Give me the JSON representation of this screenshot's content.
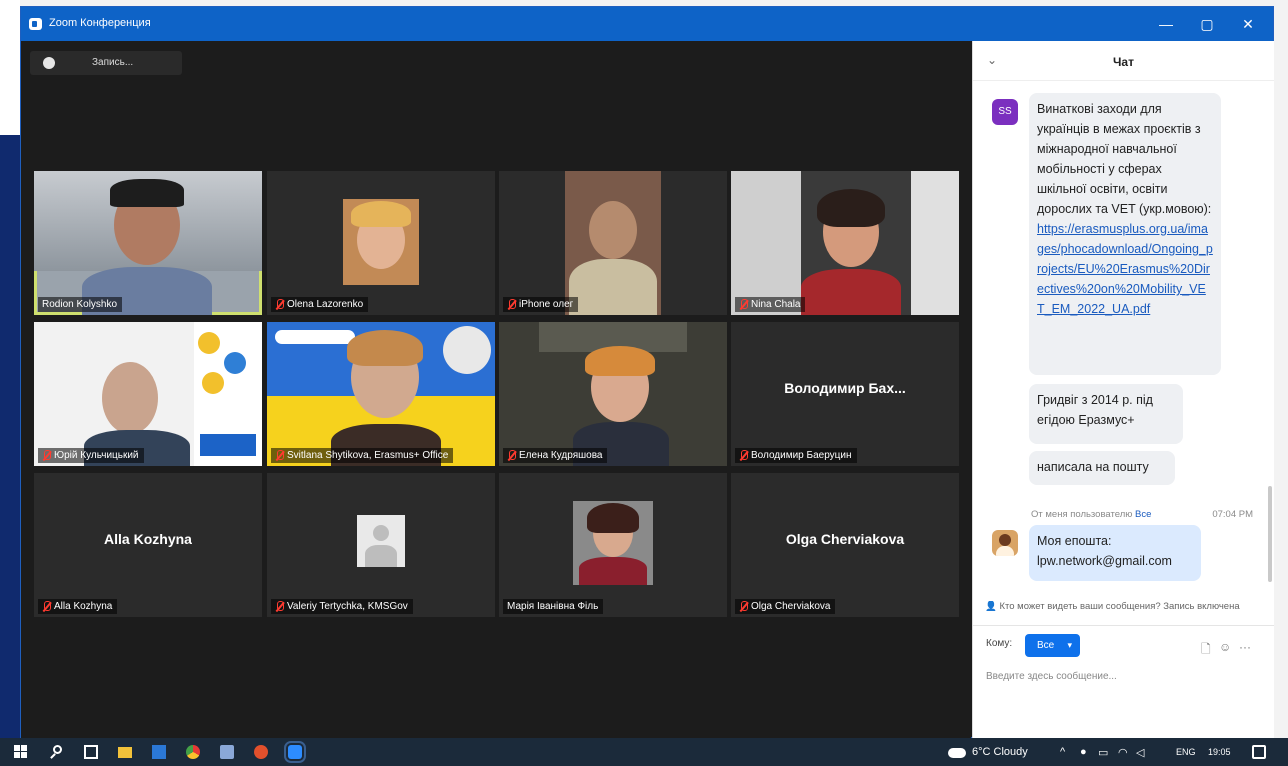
{
  "window": {
    "title": "Zoom Конференция"
  },
  "toolbar": {
    "record_label": "Запись..."
  },
  "tiles": [
    {
      "name": "Rodion Kolyshko",
      "muted": false,
      "kind": "video",
      "active": true
    },
    {
      "name": "Olena Lazorenko",
      "muted": true,
      "kind": "photo"
    },
    {
      "name": "iPhone олег",
      "muted": true,
      "kind": "video"
    },
    {
      "name": "Nina Chala",
      "muted": true,
      "kind": "video"
    },
    {
      "name": "Юрій Кульчицький",
      "muted": true,
      "kind": "video"
    },
    {
      "name": "Svitlana Shytikova, Erasmus+ Office",
      "muted": true,
      "kind": "video"
    },
    {
      "name": "Елена Кудряшова",
      "muted": true,
      "kind": "video"
    },
    {
      "name": "Володимир Баеруцин",
      "muted": true,
      "kind": "name",
      "big": "Володимир Бах..."
    },
    {
      "name": "Alla Kozhyna",
      "muted": true,
      "kind": "name",
      "big": "Alla Kozhyna"
    },
    {
      "name": "Valeriy Tertychka, KMSGov",
      "muted": true,
      "kind": "placeholder"
    },
    {
      "name": "Марія Іванівна Філь",
      "muted": false,
      "kind": "photo"
    },
    {
      "name": "Olga Cherviakova",
      "muted": true,
      "kind": "name",
      "big": "Olga Cherviakova"
    }
  ],
  "chat": {
    "title": "Чат",
    "sender_initials": "SS",
    "message1_text": "Винаткові заходи для українців в межах проєктів з міжнародної навчальної мобільності у сферах шкільної освіти, освіти дорослих та VET (укр.мовою):",
    "message1_link": "https://erasmusplus.org.ua/images/phocadownload/Ongoing_projects/EU%20Erasmus%20Directives%20on%20Mobility_VET_EM_2022_UA.pdf",
    "message2": "Гридвіг з 2014 р. під егідою Еразмус+",
    "message3": "написала на пошту",
    "meta_from": "От меня пользователю",
    "meta_to": "Все",
    "meta_time": "07:04 PM",
    "my_message": "Моя епошта: lpw.network@gmail.com",
    "visibility_note": "Кто может видеть ваши сообщения? Запись включена",
    "to_label": "Кому:",
    "to_value": "Все",
    "input_placeholder": "Введите здесь сообщение..."
  },
  "taskbar": {
    "weather": "6°C Cloudy",
    "lang": "ENG",
    "clock": "19:05"
  }
}
